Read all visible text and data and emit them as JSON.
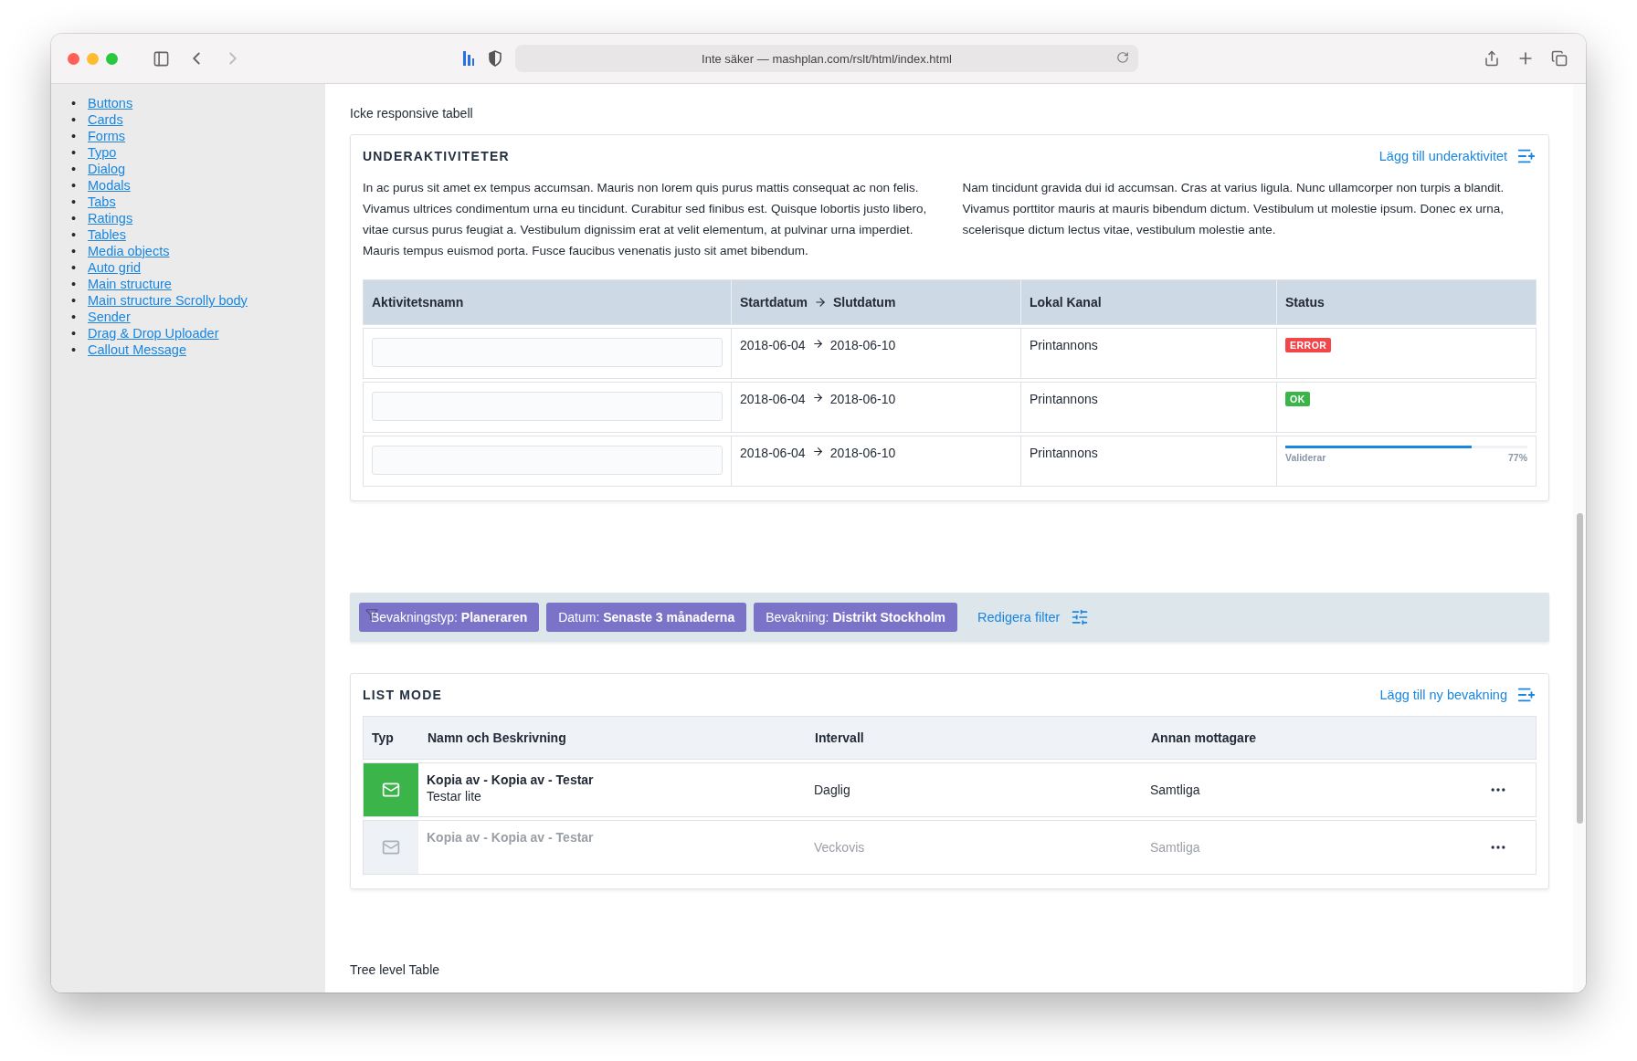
{
  "browser": {
    "url": "Inte säker — mashplan.com/rslt/html/index.html",
    "back_enabled": true,
    "forward_enabled": false
  },
  "sidebar": {
    "marker": "•",
    "links": [
      "Buttons",
      "Cards",
      "Forms",
      "Typo",
      "Dialog",
      "Modals",
      "Tabs",
      "Ratings",
      "Tables",
      "Media objects",
      "Auto grid",
      "Main structure",
      "Main structure Scrolly body",
      "Sender",
      "Drag & Drop Uploader",
      "Callout Message"
    ]
  },
  "heading": "Icke responsive tabell",
  "subactivities": {
    "title": "UNDERAKTIVITETER",
    "add_link": "Lägg till underaktivitet",
    "paragraphs": [
      "In ac purus sit amet ex tempus accumsan. Mauris non lorem quis purus mattis consequat ac non felis. Vivamus ultrices condimentum urna eu tincidunt. Curabitur sed finibus est. Quisque lobortis justo libero, vitae cursus purus feugiat a. Vestibulum dignissim erat at velit elementum, at pulvinar urna imperdiet. Mauris tempus euismod porta. Fusce faucibus venenatis justo sit amet bibendum.",
      "Nam tincidunt gravida dui id accumsan. Cras at varius ligula. Nunc ullamcorper non turpis a blandit. Vivamus porttitor mauris at mauris bibendum dictum. Vestibulum ut molestie ipsum. Donec ex urna, scelerisque dictum lectus vitae, vestibulum molestie ante."
    ],
    "columns": [
      "Aktivitetsnamn",
      "Startdatum",
      "Slutdatum",
      "Lokal Kanal",
      "Status"
    ],
    "rows": [
      {
        "start": "2018-06-04",
        "end": "2018-06-10",
        "channel": "Printannons",
        "status": {
          "kind": "badge",
          "label": "ERROR",
          "color": "#f0474b"
        }
      },
      {
        "start": "2018-06-04",
        "end": "2018-06-10",
        "channel": "Printannons",
        "status": {
          "kind": "badge",
          "label": "OK",
          "color": "#3bb54a"
        }
      },
      {
        "start": "2018-06-04",
        "end": "2018-06-10",
        "channel": "Printannons",
        "status": {
          "kind": "progress",
          "label": "Validerar",
          "reading": "77%",
          "level": 0.77
        }
      }
    ]
  },
  "filters": {
    "chips": [
      {
        "key": "Bevakningstyp:",
        "value": "Planeraren"
      },
      {
        "key": "Datum:",
        "value": "Senaste 3 månaderna"
      },
      {
        "key": "Bevakning:",
        "value": "Distrikt Stockholm"
      }
    ],
    "edit_link": "Redigera filter"
  },
  "list_mode": {
    "title": "LIST MODE",
    "add_link": "Lägg till ny bevakning",
    "columns": [
      "Typ",
      "Namn och Beskrivning",
      "Intervall",
      "Annan mottagare"
    ],
    "rows": [
      {
        "active": true,
        "name": "Kopia av - Kopia av - Testar",
        "description": "Testar lite",
        "interval": "Daglig",
        "recipient": "Samtliga"
      },
      {
        "active": false,
        "name": "Kopia av - Kopia av - Testar",
        "interval": "Veckovis",
        "recipient": "Samtliga"
      }
    ]
  },
  "next_heading": "Tree level Table"
}
